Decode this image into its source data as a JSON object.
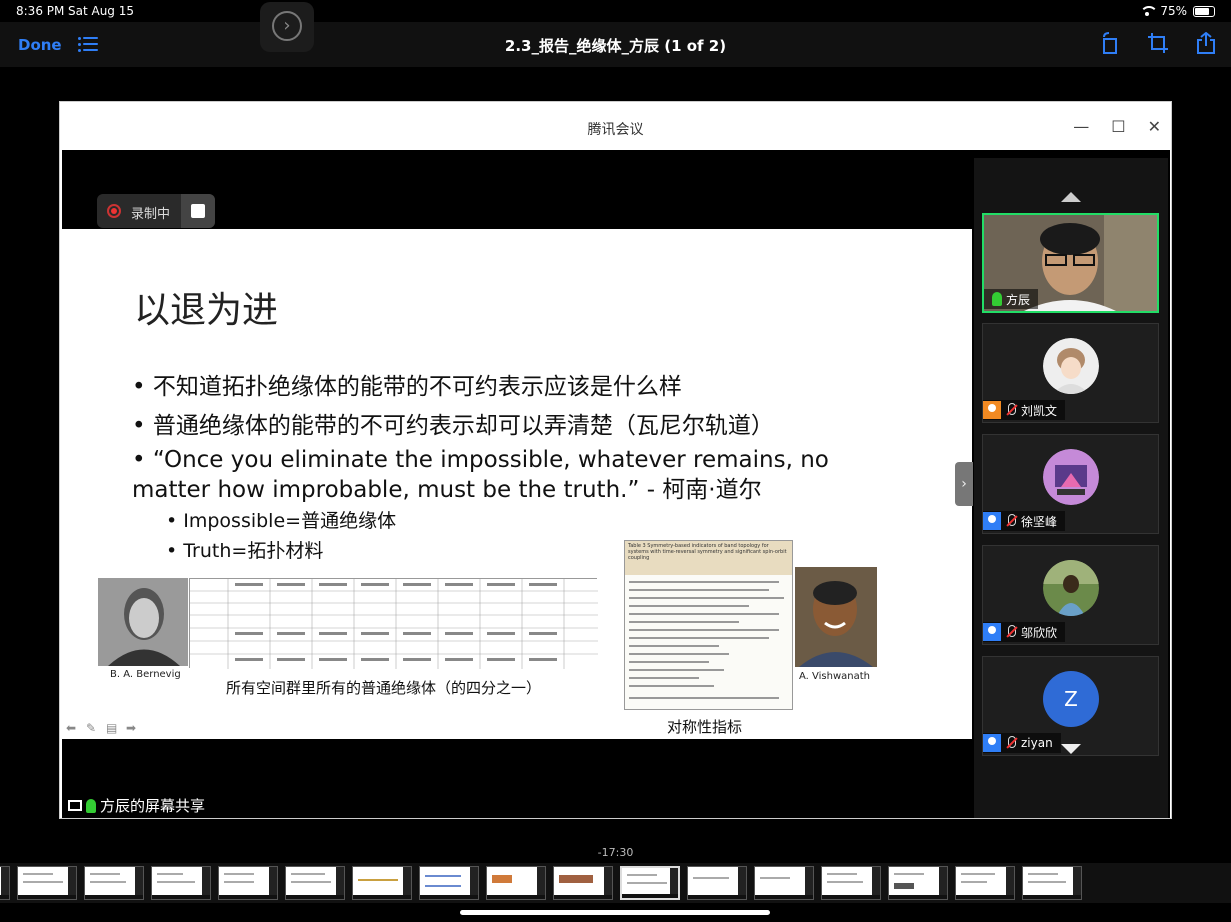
{
  "status_bar": {
    "time": "8:36 PM",
    "date": "Sat Aug 15",
    "battery": "75%"
  },
  "toolbar": {
    "done_label": "Done",
    "title": "2.3_报告_绝缘体_方辰 (1 of 2)"
  },
  "meeting": {
    "app_title": "腾讯会议",
    "recording_label": "录制中",
    "share_label": "方辰的屏幕共享"
  },
  "slide": {
    "title": "以退为进",
    "bullets": [
      "• 不知道拓扑绝缘体的能带的不可约表示应该是什么样",
      "• 普通绝缘体的能带的不可约表示却可以弄清楚（瓦尼尔轨道）",
      "•  “Once you eliminate the impossible, whatever remains, no matter how improbable, must be the truth.” - 柯南·道尔"
    ],
    "sub_bullets": [
      "• Impossible=普通绝缘体",
      "• Truth=拓扑材料"
    ],
    "left_photo_caption": "B. A. Bernevig",
    "table_caption": "所有空间群里所有的普通绝缘体（的四分之一）",
    "paper_caption": "对称性指标",
    "paper_header": "Table 3 Symmetry-based indicators of band topology for systems with time-reversal symmetry and significant spin-orbit coupling",
    "right_photo_caption": "A. Vishwanath"
  },
  "participants": [
    {
      "name": "方辰",
      "speaking": true
    },
    {
      "name": "刘凯文",
      "role": "host"
    },
    {
      "name": "徐坚峰"
    },
    {
      "name": "邬欣欣"
    },
    {
      "name": "ziyan",
      "initial": "Z"
    }
  ],
  "scrubber": {
    "time_remaining": "-17:30"
  },
  "colors": {
    "accent": "#2f7ef6",
    "speaking": "#22dd66",
    "record": "#e33333"
  },
  "icons": [
    "list-icon",
    "rotate-icon",
    "crop-icon",
    "share-icon",
    "record-dot-icon",
    "stop-icon",
    "minimize-icon",
    "maximize-icon",
    "close-icon",
    "mic-icon",
    "muted-mic-icon",
    "user-icon",
    "chevron-up-icon",
    "chevron-down-icon"
  ]
}
